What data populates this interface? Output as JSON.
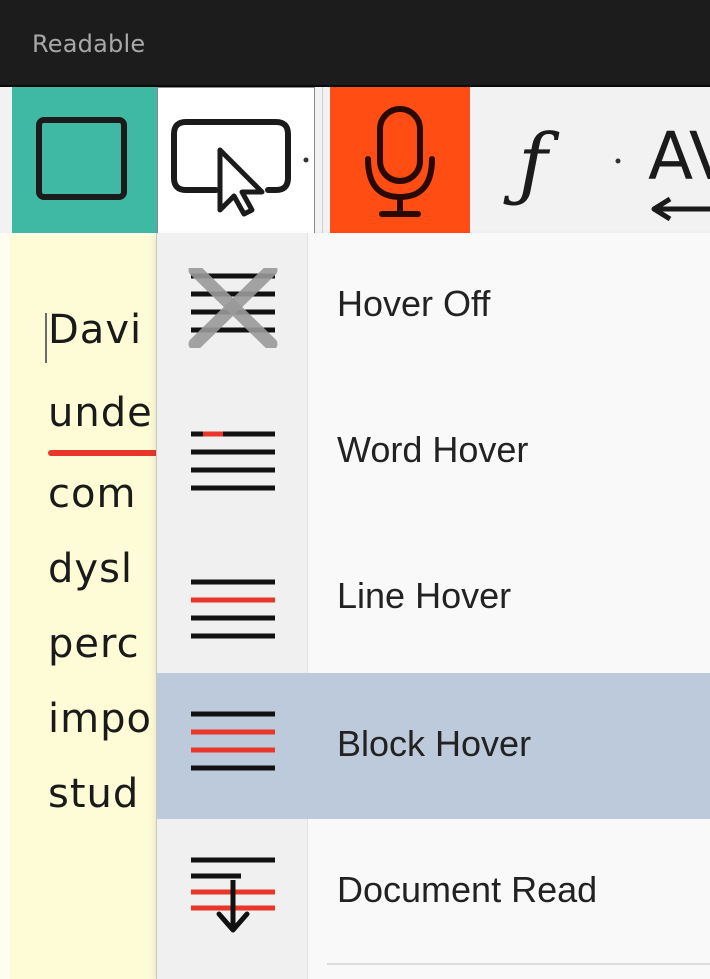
{
  "window": {
    "title": "Readable"
  },
  "toolbar": {
    "buttons": [
      {
        "icon": "square-icon",
        "accent": "#3fb9a4"
      },
      {
        "icon": "screen-cursor-icon"
      },
      {
        "icon": "microphone-icon",
        "accent": "#ff4d14"
      },
      {
        "icon": "font-f-icon"
      },
      {
        "icon": "letter-spacing-icon"
      }
    ],
    "font_glyph": "ƒ",
    "spacing_glyph": "AV"
  },
  "document": {
    "lines": [
      "Davi",
      "unde",
      "com",
      "dysl",
      "perc",
      "impo",
      "stud"
    ]
  },
  "menu": {
    "items": [
      {
        "label": "Hover Off",
        "icon": "hover-off-icon",
        "selected": false
      },
      {
        "label": "Word Hover",
        "icon": "word-hover-icon",
        "selected": false
      },
      {
        "label": "Line Hover",
        "icon": "line-hover-icon",
        "selected": false
      },
      {
        "label": "Block Hover",
        "icon": "block-hover-icon",
        "selected": true
      },
      {
        "label": "Document Read",
        "icon": "document-read-icon",
        "selected": false
      }
    ]
  },
  "colors": {
    "highlight_red": "#e8362a",
    "selected_bg": "#bccadb",
    "teal": "#3fb9a4",
    "mic_orange": "#ff4d14"
  }
}
